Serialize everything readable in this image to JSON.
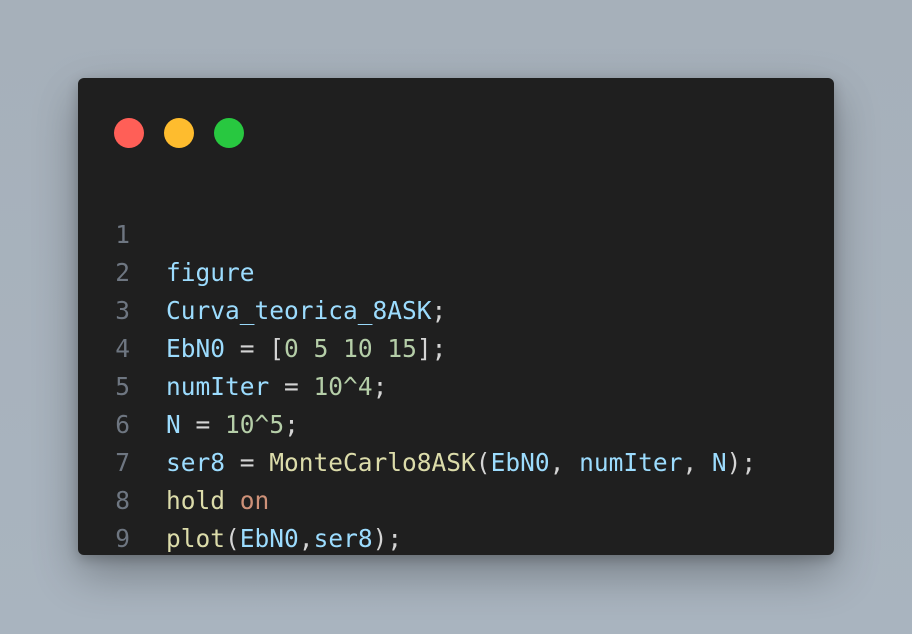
{
  "window": {
    "controls": {
      "close_color": "#ff5f57",
      "minimize_color": "#febc2e",
      "maximize_color": "#28c840"
    }
  },
  "colors": {
    "background": "#a8b3be",
    "editor": "#1f1f1f",
    "line_number": "#6e7681",
    "variable": "#9cdcfe",
    "function": "#dcdcaa",
    "number": "#b5cea8",
    "keyword_string": "#ce9178",
    "punctuation": "#d4d4d4"
  },
  "code": {
    "lines": [
      {
        "number": "1",
        "tokens": [
          "figure"
        ]
      },
      {
        "number": "2",
        "tokens": [
          "Curva_teorica_8ASK",
          ";"
        ]
      },
      {
        "number": "3",
        "tokens": [
          "EbN0",
          " = [",
          "0",
          " ",
          "5",
          " ",
          "10",
          " ",
          "15",
          "];"
        ]
      },
      {
        "number": "4",
        "tokens": [
          "numIter",
          " = ",
          "10",
          "^",
          "4",
          ";"
        ]
      },
      {
        "number": "5",
        "tokens": [
          "N",
          " = ",
          "10",
          "^",
          "5",
          ";"
        ]
      },
      {
        "number": "6",
        "tokens": [
          "ser8",
          " = ",
          "MonteCarlo8ASK",
          "(",
          "EbN0",
          ", ",
          "numIter",
          ", ",
          "N",
          ");"
        ]
      },
      {
        "number": "7",
        "tokens": [
          "hold",
          " ",
          "on"
        ]
      },
      {
        "number": "8",
        "tokens": [
          "plot",
          "(",
          "EbN0",
          ",",
          "ser8",
          ");"
        ]
      },
      {
        "number": "9",
        "tokens": []
      }
    ]
  }
}
